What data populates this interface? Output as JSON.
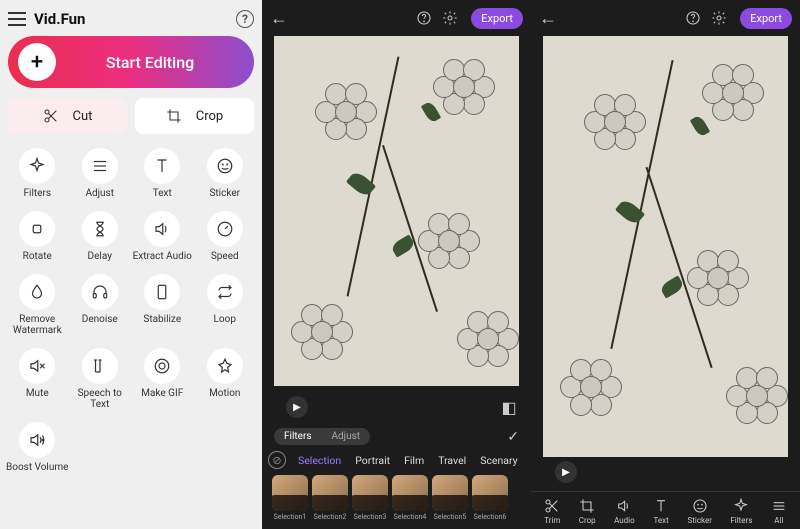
{
  "app": {
    "title": "Vid.Fun"
  },
  "main": {
    "start": "Start Editing",
    "cut": "Cut",
    "crop": "Crop"
  },
  "tools": [
    {
      "id": "filters",
      "label": "Filters",
      "icon": "sparkle"
    },
    {
      "id": "adjust",
      "label": "Adjust",
      "icon": "sliders"
    },
    {
      "id": "text",
      "label": "Text",
      "icon": "text"
    },
    {
      "id": "sticker",
      "label": "Sticker",
      "icon": "smiley"
    },
    {
      "id": "rotate",
      "label": "Rotate",
      "icon": "rotate"
    },
    {
      "id": "delay",
      "label": "Delay",
      "icon": "hourglass"
    },
    {
      "id": "extract-audio",
      "label": "Extract Audio",
      "icon": "speaker"
    },
    {
      "id": "speed",
      "label": "Speed",
      "icon": "speed"
    },
    {
      "id": "remove-watermark",
      "label": "Remove\nWatermark",
      "icon": "drop"
    },
    {
      "id": "denoise",
      "label": "Denoise",
      "icon": "headphones"
    },
    {
      "id": "stabilize",
      "label": "Stabilize",
      "icon": "phone"
    },
    {
      "id": "loop",
      "label": "Loop",
      "icon": "loop"
    },
    {
      "id": "mute",
      "label": "Mute",
      "icon": "mute"
    },
    {
      "id": "speech-text",
      "label": "Speech to\nText",
      "icon": "stt"
    },
    {
      "id": "make-gif",
      "label": "Make GIF",
      "icon": "gif"
    },
    {
      "id": "motion",
      "label": "Motion",
      "icon": "star"
    },
    {
      "id": "boost-volume",
      "label": "Boost Volume",
      "icon": "boost"
    }
  ],
  "editor": {
    "export": "Export",
    "tab_filters": "Filters",
    "tab_adjust": "Adjust",
    "cats": [
      "Selection",
      "Portrait",
      "Film",
      "Travel",
      "Scenary"
    ],
    "selected_cat": "Selection",
    "thumbs": [
      "Selection1",
      "Selection2",
      "Selection3",
      "Selection4",
      "Selection5",
      "Selection6"
    ]
  },
  "toolbar": [
    {
      "id": "trim",
      "label": "Trim",
      "icon": "scissors"
    },
    {
      "id": "crop",
      "label": "Crop",
      "icon": "crop"
    },
    {
      "id": "audio",
      "label": "Audio",
      "icon": "speaker"
    },
    {
      "id": "text",
      "label": "Text",
      "icon": "text"
    },
    {
      "id": "sticker",
      "label": "Sticker",
      "icon": "smiley"
    },
    {
      "id": "filters",
      "label": "Filters",
      "icon": "sparkle"
    },
    {
      "id": "all",
      "label": "All",
      "icon": "menu"
    }
  ]
}
